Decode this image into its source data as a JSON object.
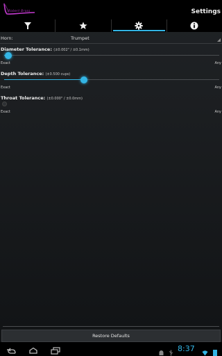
{
  "app": {
    "title": "Settings",
    "logo_text": "Robert Brass"
  },
  "tabs": [
    {
      "name": "tab-filter",
      "icon": "funnel-icon",
      "active": false
    },
    {
      "name": "tab-favorites",
      "icon": "star-icon",
      "active": false
    },
    {
      "name": "tab-settings",
      "icon": "gear-icon",
      "active": true
    },
    {
      "name": "tab-info",
      "icon": "info-icon",
      "active": false
    }
  ],
  "horn": {
    "label": "Horn:",
    "value": "Trumpet"
  },
  "tolerances": [
    {
      "title": "Diameter Tolerance:",
      "range": "(±0.002\" / ±0.1mm)",
      "min_label": "Exact",
      "max_label": "Any",
      "level": 0.02,
      "active": true
    },
    {
      "title": "Depth Tolerance:",
      "range": "(±0.500 cups)",
      "min_label": "Exact",
      "max_label": "Any",
      "level": 0.37,
      "active": true
    },
    {
      "title": "Throat Tolerance:",
      "range": "(±0.000\" / ±0.0mm)",
      "min_label": "Exact",
      "max_label": "Any",
      "level": 0.0,
      "active": false
    }
  ],
  "restore_label": "Restore Defaults",
  "status": {
    "time": "8:37"
  },
  "colors": {
    "accent": "#33b5e5",
    "logo": "#c43ad0"
  }
}
